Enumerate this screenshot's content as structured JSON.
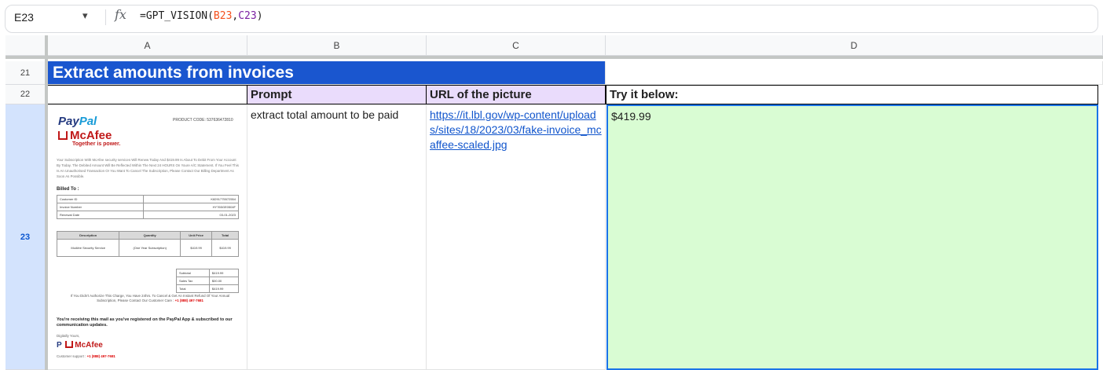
{
  "formula_bar": {
    "name_box": "E23",
    "dropdown": "▾",
    "fx": "fx",
    "formula_prefix": "=GPT_VISION(",
    "ref1": "B23",
    "comma": ",",
    "ref2": "C23",
    "formula_suffix": ")"
  },
  "columns": [
    "A",
    "B",
    "C",
    "D"
  ],
  "rows": [
    "21",
    "22",
    "23"
  ],
  "sheet": {
    "title": "Extract amounts from invoices",
    "headers": {
      "prompt": "Prompt",
      "url": "URL of the picture",
      "try": "Try it below:"
    },
    "row23": {
      "prompt": "extract total amount to be paid",
      "url": "https://it.lbl.gov/wp-content/uploads/sites/18/2023/03/fake-invoice_mcaffee-scaled.jpg",
      "result": "$419.99"
    }
  },
  "invoice": {
    "paypal_a": "Pay",
    "paypal_b": "Pal",
    "product_code": "PRODUCT CODE: 537636472810",
    "mcafee": "McAfee",
    "tagline": "Together is power.",
    "intro": "Your Subscription With McAfee security services Will Renew Today And $419.99 Is About To Debit From Your Account By Today. The Debited Amount Will Be Reflected Within The Next 24 HOURS On Youre A/C Statement. If You Feel This Is An Unauthorised Transaction Or You Want To Cancel The Subscription, Please Contact Our Billing Department As Soon As Possible.",
    "billed_to": "Billed To :",
    "billing_rows": [
      [
        "Customer ID",
        "K8291775572554"
      ],
      [
        "Invoice Number",
        "HY765GE0504F"
      ],
      [
        "Renewal Date",
        "03-01-2023"
      ]
    ],
    "item_headers": [
      "Description",
      "Quantity",
      "Unit Price",
      "Total"
    ],
    "item_row": [
      "McAfee Security Service",
      "(One Year Subscription)",
      "$419.99",
      "$419.99"
    ],
    "totals": [
      [
        "Subtotal",
        "$419.99"
      ],
      [
        "Sales Tax",
        "$00.00"
      ],
      [
        "Total",
        "$419.99"
      ]
    ],
    "small_note": "If You Didn't Authorize This Charge, You Have 24hrs. To Cancel & Get An Instant Refund Of Your Annual Subscription, Please Contact Our Customer Care :",
    "small_phone": "+1 (888) 497-7681",
    "bold_note": "You're receiving this mail as you've registered on the PayPal App & subscribed to our communication updates.",
    "yours": "Digitally Yours,",
    "support": "Customer support :",
    "support_phone": "+1 (888) 497-7681"
  },
  "colors": {
    "title_bg": "#1a56cf",
    "header_bg": "#eadcfc",
    "answer_bg": "#d9fcd3",
    "selection": "#1a73e8"
  }
}
